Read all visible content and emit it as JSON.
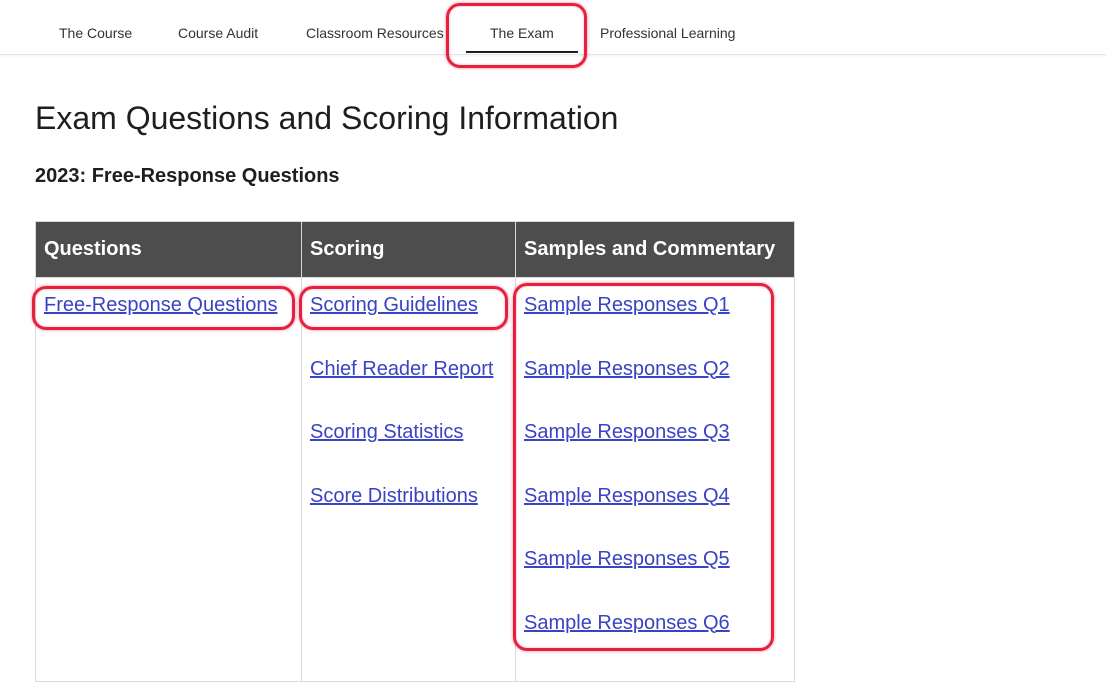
{
  "nav": {
    "tabs": [
      {
        "label": "The Course"
      },
      {
        "label": "Course Audit"
      },
      {
        "label": "Classroom Resources"
      },
      {
        "label": "The Exam"
      },
      {
        "label": "Professional Learning"
      }
    ],
    "active_tab": "The Exam"
  },
  "main": {
    "title": "Exam Questions and Scoring Information",
    "subtitle": "2023: Free-Response Questions"
  },
  "table": {
    "headers": [
      "Questions",
      "Scoring",
      "Samples and Commentary"
    ],
    "questions_links": [
      "Free-Response Questions"
    ],
    "scoring_links": [
      "Scoring Guidelines",
      "Chief Reader Report",
      "Scoring Statistics",
      "Score Distributions"
    ],
    "samples_links": [
      "Sample Responses Q1",
      "Sample Responses Q2",
      "Sample Responses Q3",
      "Sample Responses Q4",
      "Sample Responses Q5",
      "Sample Responses Q6"
    ]
  },
  "colors": {
    "header_bg": "#4d4d4d",
    "link": "#3843c5",
    "annotation": "#e5213f"
  }
}
